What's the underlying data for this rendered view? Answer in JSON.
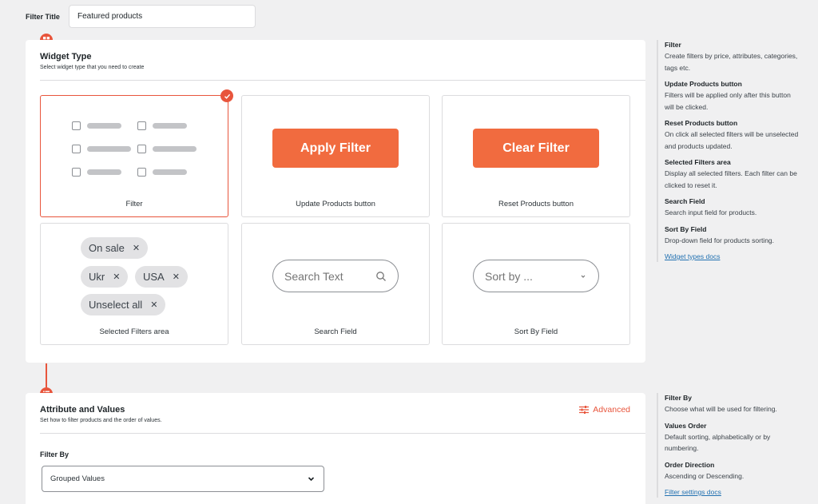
{
  "filter_title": {
    "label": "Filter Title",
    "value": "Featured products"
  },
  "widget_type": {
    "title": "Widget Type",
    "subtitle": "Select widget type that you need to create",
    "cards": [
      {
        "label": "Filter",
        "selected": true
      },
      {
        "label": "Update Products button",
        "button_text": "Apply Filter"
      },
      {
        "label": "Reset Products button",
        "button_text": "Clear Filter"
      },
      {
        "label": "Selected Filters area",
        "chips": [
          "On sale",
          "Ukr",
          "USA",
          "Unselect all"
        ]
      },
      {
        "label": "Search Field",
        "placeholder": "Search Text"
      },
      {
        "label": "Sort By Field",
        "placeholder": "Sort by ..."
      }
    ]
  },
  "widget_help": {
    "items": [
      {
        "title": "Filter",
        "desc": "Create filters by price, attributes, categories, tags etc."
      },
      {
        "title": "Update Products button",
        "desc": "Filters will be applied only after this button will be clicked."
      },
      {
        "title": "Reset Products button",
        "desc": "On click all selected filters will be unselected and products updated."
      },
      {
        "title": "Selected Filters area",
        "desc": "Display all selected filters. Each filter can be clicked to reset it."
      },
      {
        "title": "Search Field",
        "desc": "Search input field for products."
      },
      {
        "title": "Sort By Field",
        "desc": "Drop-down field for products sorting."
      }
    ],
    "link": "Widget types docs"
  },
  "attribute_values": {
    "title": "Attribute and Values",
    "subtitle": "Set how to filter products and the order of values.",
    "advanced_label": "Advanced",
    "filter_by_label": "Filter By",
    "filter_by_value": "Grouped Values"
  },
  "attribute_help": {
    "items": [
      {
        "title": "Filter By",
        "desc": "Choose what will be used for filtering."
      },
      {
        "title": "Values Order",
        "desc": "Default sorting, alphabetically or by numbering."
      },
      {
        "title": "Order Direction",
        "desc": "Ascending or Descending."
      }
    ],
    "link": "Filter settings docs"
  },
  "colors": {
    "accent": "#e8553c",
    "button": "#f16b3f",
    "link": "#2271b1"
  }
}
